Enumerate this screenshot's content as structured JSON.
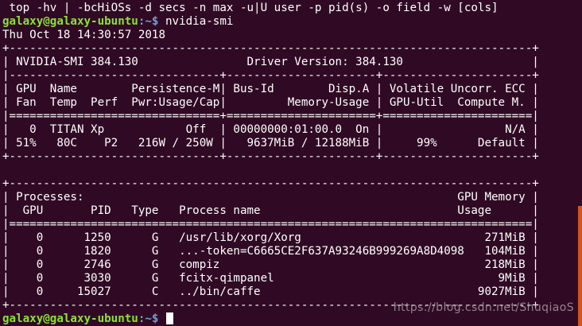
{
  "terminal": {
    "usage_line": " top -hv | -bcHiOSs -d secs -n max -u|U user -p pid(s) -o field -w [cols]",
    "prompt_user": "galaxy@galaxy-ubuntu",
    "prompt_path": ":~$",
    "command": " nvidia-smi",
    "timestamp": "Thu Oct 18 14:30:57 2018",
    "smi": {
      "border_top": "+-----------------------------------------------------------------------------+",
      "version_line": "| NVIDIA-SMI 384.130                Driver Version: 384.130                   |",
      "separator": "|-------------------------------+----------------------+----------------------+",
      "header_line_1": "| GPU  Name        Persistence-M| Bus-Id        Disp.A | Volatile Uncorr. ECC |",
      "header_line_2": "| Fan  Temp  Perf  Pwr:Usage/Cap|         Memory-Usage | GPU-Util  Compute M. |",
      "double_separator": "|===============================+======================+======================|",
      "gpu_line_1": "|   0  TITAN Xp            Off  | 00000000:01:00.0  On |                  N/A |",
      "gpu_line_2": "| 51%   80C    P2   216W / 250W |   9637MiB / 12188MiB |     99%      Default |",
      "gpu_border_bottom": "+-------------------------------+----------------------+----------------------+",
      "blank": " ",
      "proc_border_top": "+-----------------------------------------------------------------------------+",
      "proc_header_1": "| Processes:                                                       GPU Memory |",
      "proc_header_2": "|  GPU       PID   Type   Process name                             Usage      |",
      "proc_double_separator": "|=============================================================================|",
      "processes": [
        "|    0      1250      G   /usr/lib/xorg/Xorg                           271MiB |",
        "|    0      1820      G   ...-token=C6665CE2F637A93246B999269A8D4098   104MiB |",
        "|    0      2746      G   compiz                                       218MiB |",
        "|    0      3030      G   fcitx-qimpanel                                 9MiB |",
        "|    0     15027      C   ../bin/caffe                                9027MiB |"
      ],
      "proc_border_bottom": "+-----------------------------------------------------------------------------+"
    },
    "final_prompt_path": ":~$ "
  },
  "watermark": "https://blog.csdn.net/ShuqiaoS",
  "colors": {
    "background": "#300a24",
    "text": "#ffffff",
    "prompt_user": "#8ae234",
    "prompt_path": "#729fcf",
    "scrollbar": "#d2541f"
  }
}
